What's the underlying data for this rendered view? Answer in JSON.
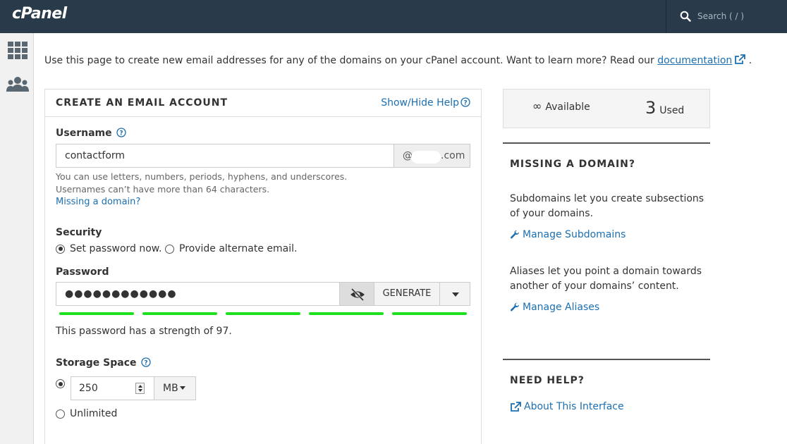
{
  "topbar": {
    "logo": "cPanel",
    "search_placeholder": "Search ( / )"
  },
  "sidebar": {
    "icons": [
      "grid-icon",
      "users-icon"
    ]
  },
  "intro": {
    "text": "Use this page to create new email addresses for any of the domains on your cPanel account. Want to learn more? Read our ",
    "link": "documentation",
    "suffix": "."
  },
  "form": {
    "title": "CREATE AN EMAIL ACCOUNT",
    "show_hide_help": "Show/Hide Help",
    "username_label": "Username",
    "username_value": "contactform",
    "domain_prefix": "@",
    "domain_suffix": ".com",
    "username_help_1": "You can use letters, numbers, periods, hyphens, and underscores.",
    "username_help_2": "Usernames can’t have more than 64 characters.",
    "missing_domain_link": "Missing a domain?",
    "security_label": "Security",
    "security_options": [
      "Set password now.",
      "Provide alternate email."
    ],
    "security_selected": 0,
    "password_label": "Password",
    "password_value": "●●●●●●●●●●●●",
    "generate_label": "GENERATE",
    "strength_segments": 5,
    "strength_color": "#1ee01e",
    "strength_text": "This password has a strength of 97.",
    "storage_label": "Storage Space",
    "storage_value": "250",
    "storage_unit": "MB",
    "unlimited_label": "Unlimited"
  },
  "stats": {
    "available_symbol": "∞",
    "available_label": "Available",
    "used_count": "3",
    "used_label": "Used"
  },
  "missing_domain": {
    "heading": "MISSING A DOMAIN?",
    "subdomains_text": "Subdomains let you create subsections of your domains.",
    "subdomains_link": "Manage Subdomains",
    "aliases_text": "Aliases let you point a domain towards another of your domains’ content.",
    "aliases_link": "Manage Aliases"
  },
  "need_help": {
    "heading": "NEED HELP?",
    "link": "About This Interface"
  },
  "colors": {
    "topbar": "#293a4a",
    "link": "#1b6fb0",
    "strength": "#1ee01e"
  }
}
